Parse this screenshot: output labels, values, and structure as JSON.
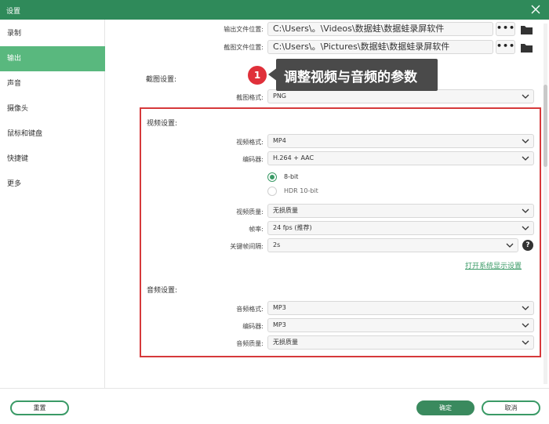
{
  "window": {
    "title": "设置",
    "close_icon": "close-icon"
  },
  "sidebar": {
    "items": [
      {
        "label": "录制"
      },
      {
        "label": "输出"
      },
      {
        "label": "声音"
      },
      {
        "label": "摄像头"
      },
      {
        "label": "鼠标和键盘"
      },
      {
        "label": "快捷键"
      },
      {
        "label": "更多"
      }
    ],
    "active_index": 1
  },
  "output": {
    "video_path_label": "输出文件位置:",
    "video_path_value": "C:\\Users\\。\\Videos\\数据蛙\\数据蛙录屏软件",
    "screenshot_path_label": "截图文件位置:",
    "screenshot_path_value": "C:\\Users\\。\\Pictures\\数据蛙\\数据蛙录屏软件",
    "more_button": "•••"
  },
  "annotation": {
    "number": "1",
    "text": "调整视频与音频的参数"
  },
  "screenshot_settings": {
    "title": "截图设置:",
    "format_label": "截图格式:",
    "format_value": "PNG"
  },
  "video_settings": {
    "title": "视频设置:",
    "format_label": "视频格式:",
    "format_value": "MP4",
    "encoder_label": "编码器:",
    "encoder_value": "H.264 + AAC",
    "bit_options": [
      "8-bit",
      "HDR 10-bit"
    ],
    "bit_selected": "8-bit",
    "quality_label": "视频质量:",
    "quality_value": "无损质量",
    "framerate_label": "帧率:",
    "framerate_value": "24 fps (推荐)",
    "keyframe_label": "关键帧间隔:",
    "keyframe_value": "2s",
    "help_symbol": "?",
    "system_display_link": "打开系统显示设置"
  },
  "audio_settings": {
    "title": "音频设置:",
    "format_label": "音频格式:",
    "format_value": "MP3",
    "encoder_label": "编码器:",
    "encoder_value": "MP3",
    "quality_label": "音频质量:",
    "quality_value": "无损质量"
  },
  "footer": {
    "reset_label": "重置",
    "ok_label": "确定",
    "cancel_label": "取消"
  },
  "colors": {
    "title_bar": "#2f8a5a",
    "sidebar_active": "#59b87e",
    "accent": "#3a9a66",
    "highlight_box": "#d6393b",
    "annotation_badge": "#e0303a"
  }
}
